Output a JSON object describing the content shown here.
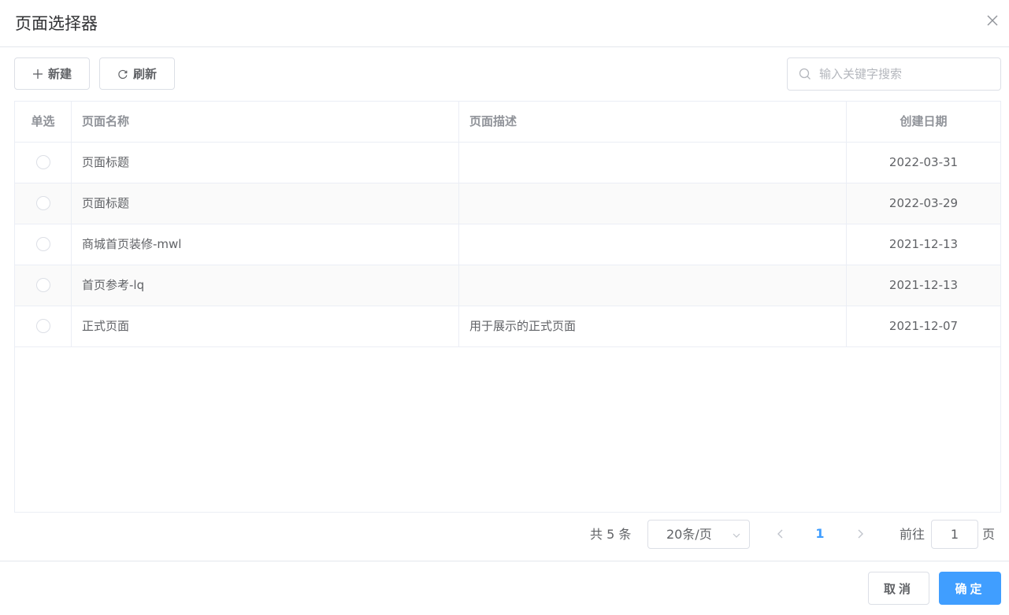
{
  "dialog": {
    "title": "页面选择器"
  },
  "toolbar": {
    "new_label": "新建",
    "refresh_label": "刷新"
  },
  "search": {
    "placeholder": "输入关键字搜索",
    "value": ""
  },
  "table": {
    "columns": [
      "单选",
      "页面名称",
      "页面描述",
      "创建日期"
    ],
    "rows": [
      {
        "name": "页面标题",
        "desc": "",
        "date": "2022-03-31"
      },
      {
        "name": "页面标题",
        "desc": "",
        "date": "2022-03-29"
      },
      {
        "name": "商城首页装修-mwl",
        "desc": "",
        "date": "2021-12-13"
      },
      {
        "name": "首页参考-lq",
        "desc": "",
        "date": "2021-12-13"
      },
      {
        "name": "正式页面",
        "desc": "用于展示的正式页面",
        "date": "2021-12-07"
      }
    ]
  },
  "pagination": {
    "total": "共 5 条",
    "page_size": "20条/页",
    "current_page": "1",
    "goto_label": "前往",
    "goto_value": "1",
    "goto_unit": "页"
  },
  "footer": {
    "cancel_label": "取消",
    "confirm_label": "确定"
  },
  "colors": {
    "primary": "#409eff",
    "border": "#dcdfe6",
    "stripe": "#fafafa"
  }
}
